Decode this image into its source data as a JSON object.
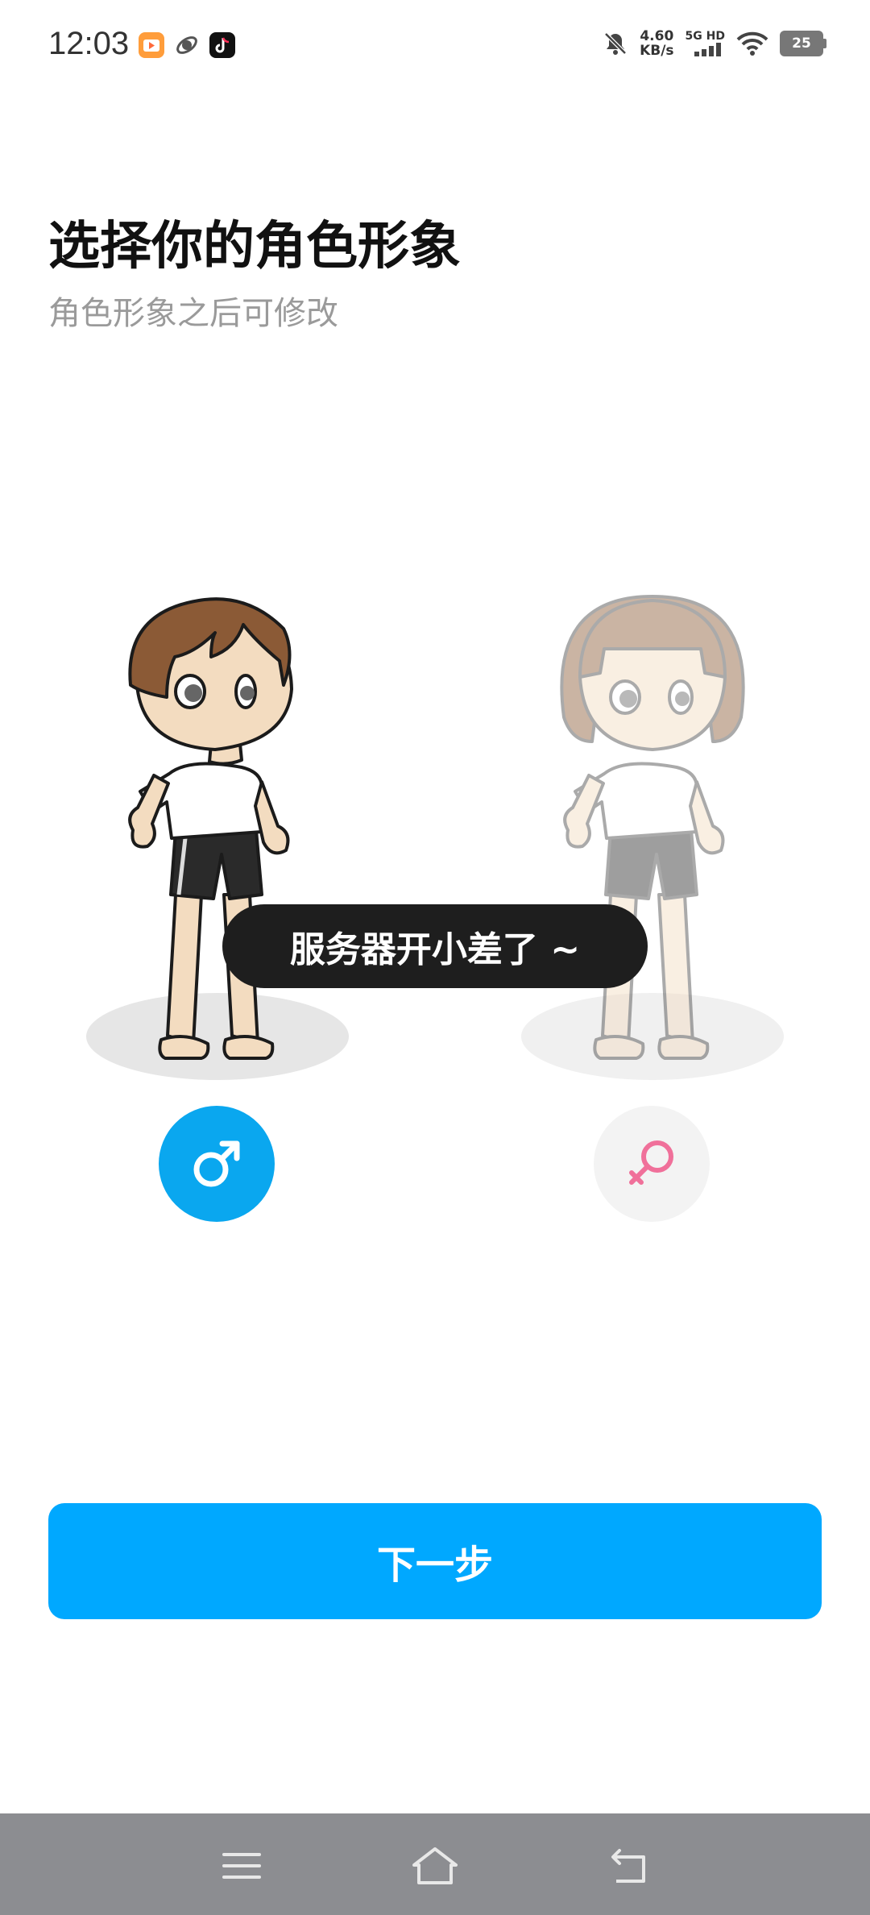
{
  "status_bar": {
    "time": "12:03",
    "net_speed": "4.60",
    "net_unit": "KB/s",
    "network_label": "5G HD",
    "battery": "25"
  },
  "header": {
    "title": "选择你的角色形象",
    "subtitle": "角色形象之后可修改"
  },
  "toast": {
    "message": "服务器开小差了 ~"
  },
  "actions": {
    "next_label": "下一步"
  },
  "gender": {
    "selected": "male",
    "male_icon": "male-symbol-icon",
    "female_icon": "female-symbol-icon"
  },
  "colors": {
    "accent": "#00a8ff",
    "female_icon": "#f0709a",
    "toast_bg": "#1e1e1e",
    "nav_bar": "#8c8d91"
  }
}
